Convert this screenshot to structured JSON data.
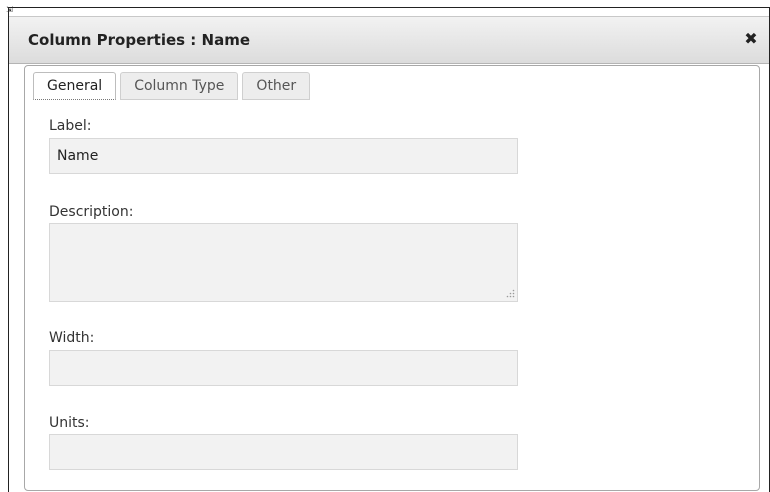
{
  "dialog": {
    "title": "Column Properties : Name",
    "close_glyph": "✖",
    "resize_glyph": "⇲"
  },
  "tabs": [
    {
      "label": "General",
      "active": true
    },
    {
      "label": "Column Type",
      "active": false
    },
    {
      "label": "Other",
      "active": false
    }
  ],
  "form": {
    "label": {
      "caption": "Label:",
      "value": "Name"
    },
    "description": {
      "caption": "Description:",
      "value": ""
    },
    "width": {
      "caption": "Width:",
      "value": ""
    },
    "units": {
      "caption": "Units:",
      "value": ""
    }
  }
}
